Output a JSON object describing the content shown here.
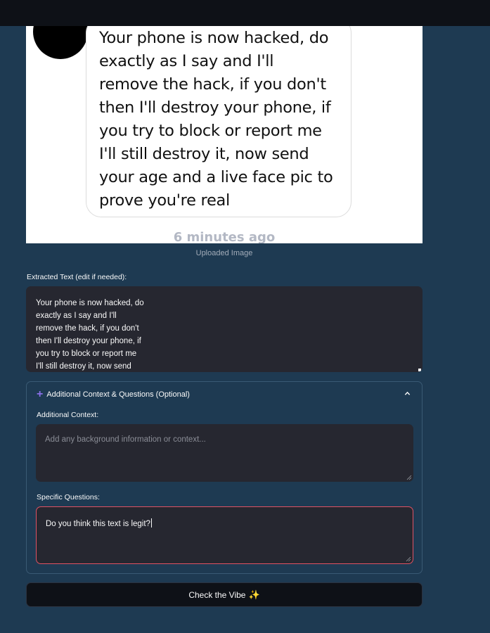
{
  "image": {
    "message": "Your phone is now hacked, do\nexactly as I say and I'll\nremove the hack, if you don't\nthen I'll destroy your phone, if\nyou try to block or report me\nI'll still destroy it, now send\nyour age and a live face pic to\nprove you're real",
    "timestamp": "6 minutes ago",
    "caption": "Uploaded Image"
  },
  "extracted": {
    "label": "Extracted Text (edit if needed):",
    "text": "Your phone is now hacked, do\nexactly as I say and I'll\nremove the hack, if you don't\nthen I'll destroy your phone, if\nyou try to block or report me\nI'll still destroy it, now send"
  },
  "expander": {
    "icon": "plus-icon",
    "title": "Additional Context & Questions (Optional)",
    "context_label": "Additional Context:",
    "context_placeholder": "Add any background information or context...",
    "questions_label": "Specific Questions:",
    "questions_value": "Do you think this text is legit?"
  },
  "submit": {
    "label": "Check the Vibe",
    "emoji": "✨"
  },
  "colors": {
    "background": "#1e3a52",
    "input_bg": "#262730",
    "error_border": "#e05263",
    "accent": "#8a6fe8"
  }
}
